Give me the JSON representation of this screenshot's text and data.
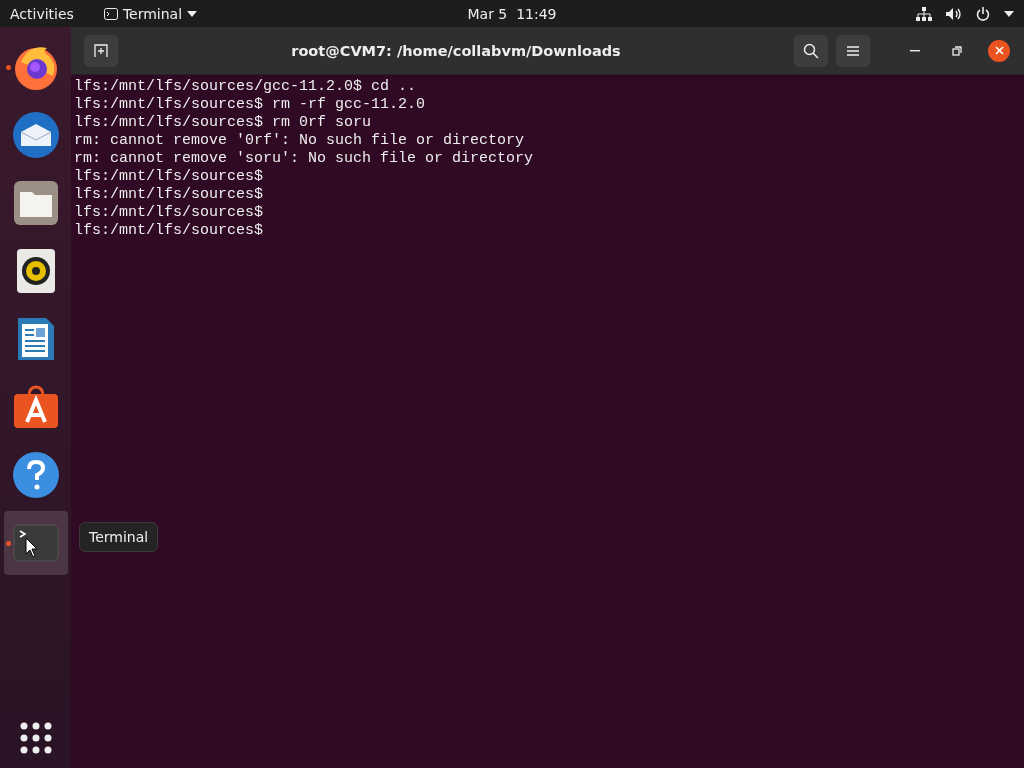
{
  "top_bar": {
    "activities": "Activities",
    "app_menu": "Terminal",
    "clock": "Mar 5  11:49"
  },
  "dock": {
    "items": [
      {
        "kind": "firefox",
        "running": true,
        "selected": false
      },
      {
        "kind": "thunderbird",
        "running": false,
        "selected": false
      },
      {
        "kind": "files",
        "running": false,
        "selected": false
      },
      {
        "kind": "rhythmbox",
        "running": false,
        "selected": false
      },
      {
        "kind": "writer",
        "running": false,
        "selected": false
      },
      {
        "kind": "software",
        "running": false,
        "selected": false
      },
      {
        "kind": "help",
        "running": false,
        "selected": false
      },
      {
        "kind": "terminal",
        "running": true,
        "selected": true
      }
    ],
    "tooltip": "Terminal"
  },
  "window": {
    "title": "root@CVM7: /home/collabvm/Downloads",
    "lines": [
      "lfs:/mnt/lfs/sources/gcc-11.2.0$ cd ..",
      "lfs:/mnt/lfs/sources$ rm -rf gcc-11.2.0",
      "lfs:/mnt/lfs/sources$ rm 0rf soru",
      "rm: cannot remove '0rf': No such file or directory",
      "rm: cannot remove 'soru': No such file or directory",
      "lfs:/mnt/lfs/sources$",
      "lfs:/mnt/lfs/sources$",
      "lfs:/mnt/lfs/sources$",
      "lfs:/mnt/lfs/sources$"
    ]
  }
}
